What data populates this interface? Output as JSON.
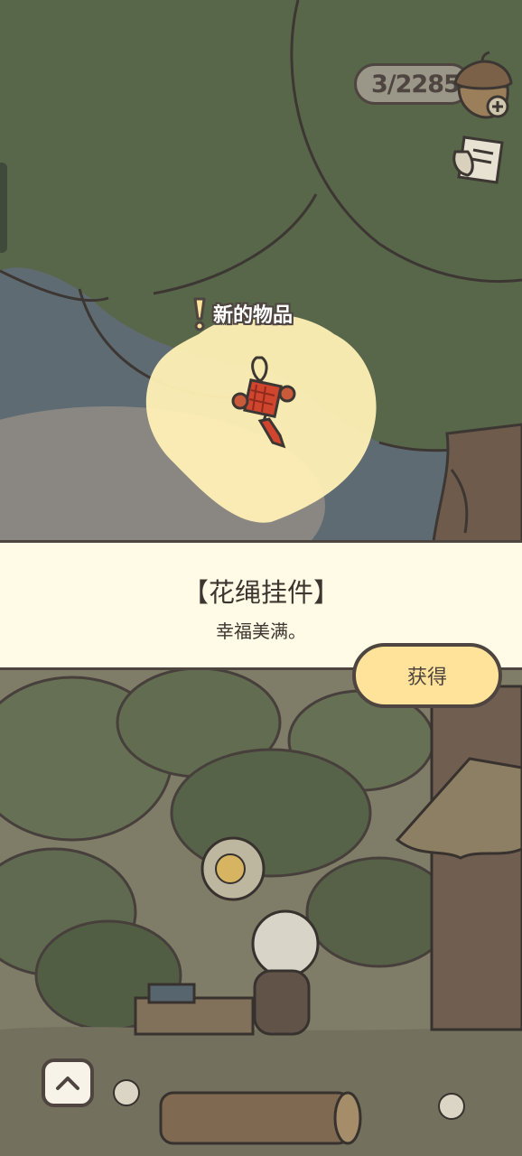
{
  "hud": {
    "acorn_count": "3/2285",
    "acorn_icon": "acorn-icon",
    "add_icon": "plus-icon",
    "notebook_icon": "notebook-icon"
  },
  "popup": {
    "badge": "新的物品",
    "badge_icon": "exclamation-icon",
    "item_icon": "chinese-knot-icon",
    "item_name": "【花绳挂件】",
    "item_description": "幸福美满。",
    "get_button_label": "获得"
  },
  "controls": {
    "expand_icon": "chevron-up-icon"
  },
  "colors": {
    "outline": "#4e4540",
    "panel_background": "#fffbe6",
    "button_fill": "#ffe39a",
    "glow": "#fff0b5",
    "knot_red": "#d0452e"
  }
}
